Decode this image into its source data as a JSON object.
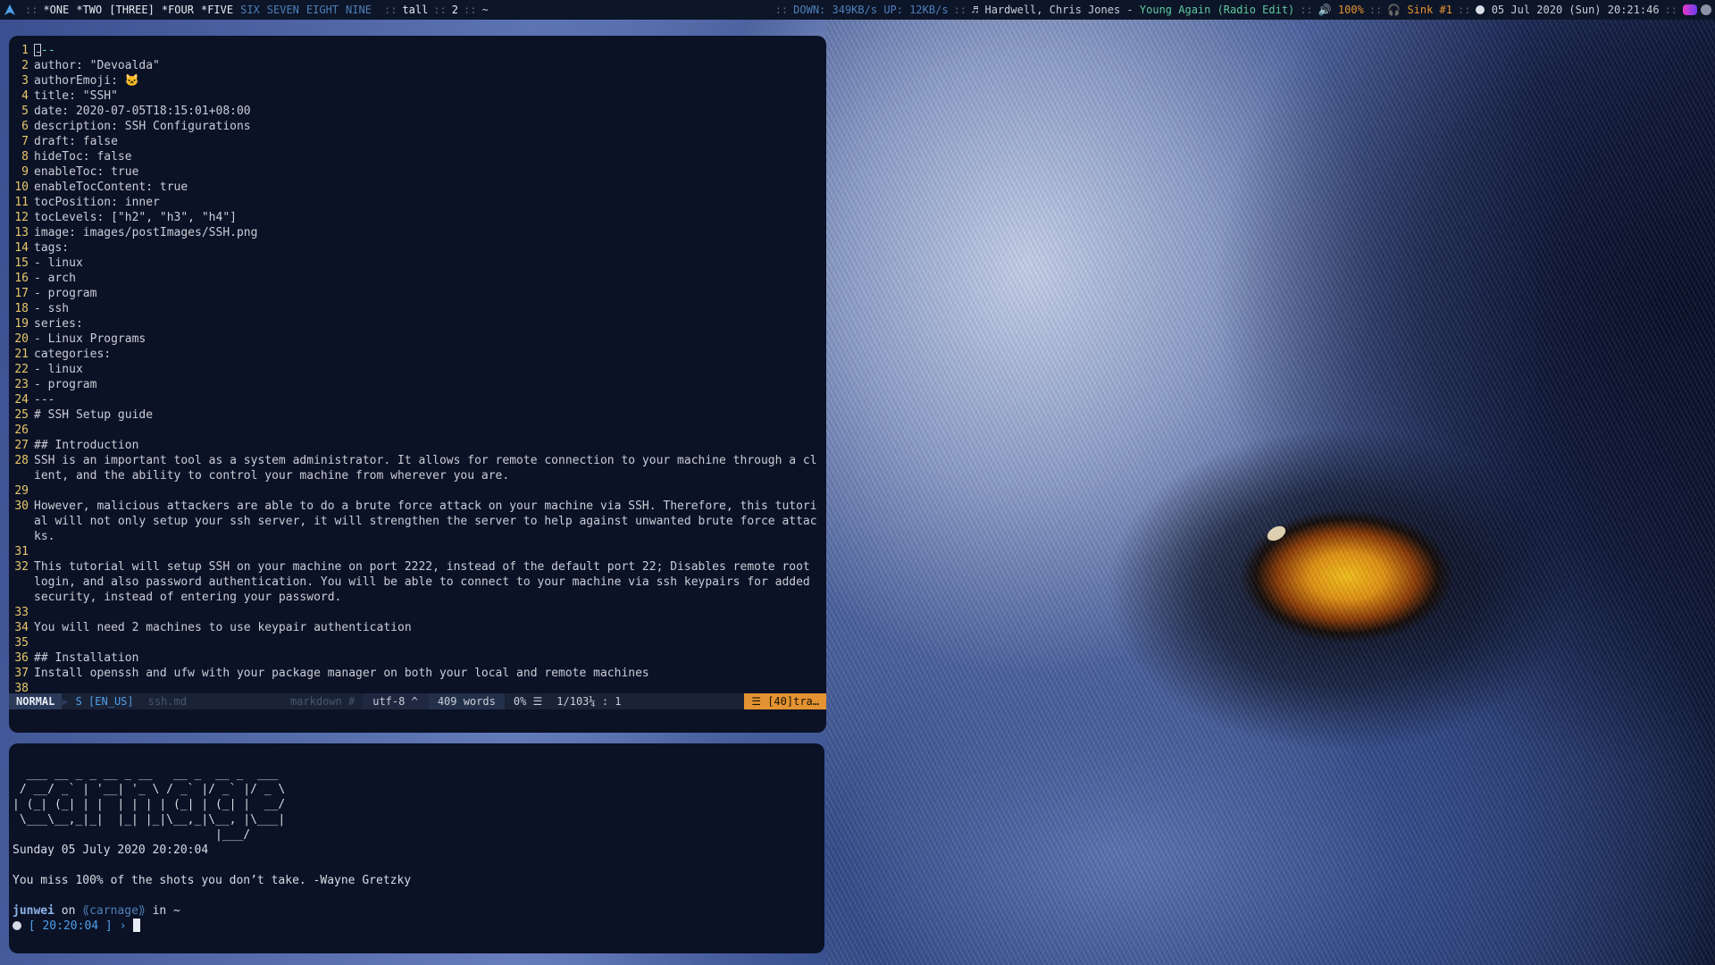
{
  "topbar": {
    "workspaces": [
      {
        "label": "*ONE",
        "state": "active"
      },
      {
        "label": "*TWO",
        "state": "active"
      },
      {
        "label": "[THREE]",
        "state": "current"
      },
      {
        "label": "*FOUR",
        "state": "active"
      },
      {
        "label": "*FIVE",
        "state": "active"
      },
      {
        "label": "SIX",
        "state": "empty"
      },
      {
        "label": "SEVEN",
        "state": "empty"
      },
      {
        "label": "EIGHT",
        "state": "empty"
      },
      {
        "label": "NINE",
        "state": "empty"
      }
    ],
    "layout": "tall",
    "window_count": "2",
    "cwd": "~",
    "net_down": "DOWN: 349KB/s",
    "net_up": "UP: 12KB/s",
    "music_artist": "Hardwell, Chris Jones",
    "music_title": "Young Again (Radio Edit)",
    "volume": "100%",
    "sink": "Sink #1",
    "datetime": "05 Jul 2020 (Sun) 20:21:46",
    "separator": "::",
    "dash": "-"
  },
  "vim": {
    "lines": [
      {
        "n": "1",
        "t": "---"
      },
      {
        "n": "2",
        "t": "author: \"Devoalda\""
      },
      {
        "n": "3",
        "t": "authorEmoji: 🐱"
      },
      {
        "n": "4",
        "t": "title: \"SSH\""
      },
      {
        "n": "5",
        "t": "date: 2020-07-05T18:15:01+08:00"
      },
      {
        "n": "6",
        "t": "description: SSH Configurations"
      },
      {
        "n": "7",
        "t": "draft: false"
      },
      {
        "n": "8",
        "t": "hideToc: false"
      },
      {
        "n": "9",
        "t": "enableToc: true"
      },
      {
        "n": "10",
        "t": "enableTocContent: true"
      },
      {
        "n": "11",
        "t": "tocPosition: inner"
      },
      {
        "n": "12",
        "t": "tocLevels: [\"h2\", \"h3\", \"h4\"]"
      },
      {
        "n": "13",
        "t": "image: images/postImages/SSH.png"
      },
      {
        "n": "14",
        "t": "tags:"
      },
      {
        "n": "15",
        "t": "- linux"
      },
      {
        "n": "16",
        "t": "- arch"
      },
      {
        "n": "17",
        "t": "- program"
      },
      {
        "n": "18",
        "t": "- ssh"
      },
      {
        "n": "19",
        "t": "series:"
      },
      {
        "n": "20",
        "t": "- Linux Programs"
      },
      {
        "n": "21",
        "t": "categories:"
      },
      {
        "n": "22",
        "t": "- linux"
      },
      {
        "n": "23",
        "t": "- program"
      },
      {
        "n": "24",
        "t": "---"
      },
      {
        "n": "25",
        "t": "# SSH Setup guide"
      },
      {
        "n": "26",
        "t": ""
      },
      {
        "n": "27",
        "t": "## Introduction"
      },
      {
        "n": "28",
        "t": "SSH is an important tool as a system administrator. It allows for remote connection to your machine through a client, and the ability to control your machine from wherever you are."
      },
      {
        "n": "29",
        "t": ""
      },
      {
        "n": "30",
        "t": "However, malicious attackers are able to do a brute force attack on your machine via SSH. Therefore, this tutorial will not only setup your ssh server, it will strengthen the server to help against unwanted brute force attacks."
      },
      {
        "n": "31",
        "t": ""
      },
      {
        "n": "32",
        "t": "This tutorial will setup SSH on your machine on port 2222, instead of the default port 22; Disables remote root login, and also password authentication. You will be able to connect to your machine via ssh keypairs for added security, instead of entering your password."
      },
      {
        "n": "33",
        "t": ""
      },
      {
        "n": "34",
        "t": "You will need 2 machines to use keypair authentication"
      },
      {
        "n": "35",
        "t": ""
      },
      {
        "n": "36",
        "t": "## Installation"
      },
      {
        "n": "37",
        "t": "Install openssh and ufw with your package manager on both your local and remote machines"
      },
      {
        "n": "38",
        "t": ""
      }
    ],
    "status": {
      "mode": "NORMAL",
      "spell": "S [EN_US]",
      "file": "ssh.md",
      "filetype": "markdown #",
      "encoding": "utf-8 ^",
      "words": "409 words",
      "percent": "0% ☰",
      "position": "1/103¼ :  1",
      "warning": "☰ [40]tra…"
    }
  },
  "shell": {
    "ascii": [
      "  ___ __ _ _ __ _ __   __ _  __ _  ___ ",
      " / __/ _` | '__| '_ \\ / _` |/ _` |/ _ \\",
      "| (_| (_| | |  | | | | (_| | (_| |  __/",
      " \\___\\__,_|_|  |_| |_|\\__,_|\\__, |\\___|",
      "                             |___/     "
    ],
    "date_line": "Sunday 05 July 2020 20:20:04",
    "quote": "You miss 100% of the shots you don’t take. -Wayne Gretzky",
    "user": "junwei",
    "on": "on",
    "host": "⟪carnage⟫",
    "in": "in ~",
    "prompt_time": "[ 20:20:04 ]",
    "prompt_arrow": "›"
  },
  "colors": {
    "terminal_bg": "#0b1226",
    "line_number": "#e8c76a",
    "accent_blue": "#4e7fb8",
    "warning_orange": "#e49332",
    "music_green": "#5ec8a0"
  }
}
